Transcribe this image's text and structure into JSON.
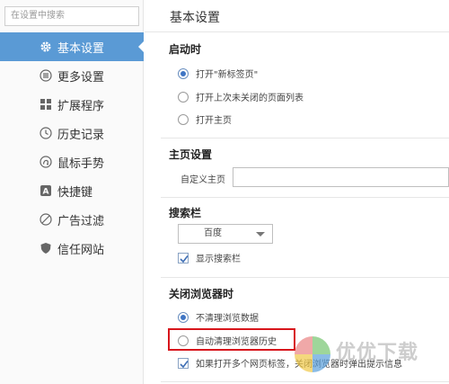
{
  "search": {
    "placeholder": "在设置中搜索"
  },
  "sidebar": {
    "items": [
      {
        "label": "基本设置",
        "icon": "gear-icon",
        "active": true
      },
      {
        "label": "更多设置",
        "icon": "list-icon",
        "active": false
      },
      {
        "label": "扩展程序",
        "icon": "grid-icon",
        "active": false
      },
      {
        "label": "历史记录",
        "icon": "clock-icon",
        "active": false
      },
      {
        "label": "鼠标手势",
        "icon": "gesture-icon",
        "active": false
      },
      {
        "label": "快捷键",
        "icon": "key-a-icon",
        "active": false
      },
      {
        "label": "广告过滤",
        "icon": "block-icon",
        "active": false
      },
      {
        "label": "信任网站",
        "icon": "shield-icon",
        "active": false
      }
    ]
  },
  "main": {
    "title": "基本设置",
    "startup": {
      "title": "启动时",
      "options": [
        "打开\"新标签页\"",
        "打开上次未关闭的页面列表",
        "打开主页"
      ],
      "selected": 0
    },
    "homepage": {
      "title": "主页设置",
      "label": "自定义主页",
      "value": ""
    },
    "searchbar": {
      "title": "搜索栏",
      "engine": "百度",
      "show_label": "显示搜索栏",
      "show_checked": true
    },
    "close_browser": {
      "title": "关闭浏览器时",
      "options": [
        "不清理浏览数据",
        "自动清理浏览器历史"
      ],
      "selected": 0,
      "warn_label": "如果打开多个网页标签，关闭浏览器时弹出提示信息",
      "warn_checked": true
    }
  },
  "watermark": {
    "text": "优优下载"
  },
  "colors": {
    "accent": "#5a9ad5",
    "radio": "#3f75c4",
    "highlight": "#d8161c"
  }
}
